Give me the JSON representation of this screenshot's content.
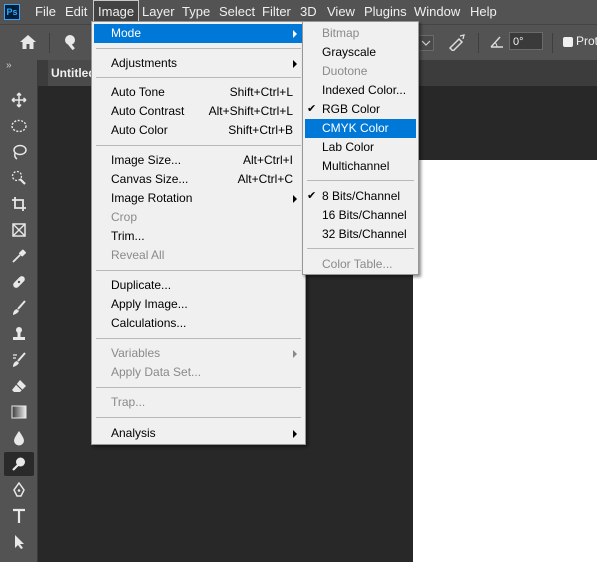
{
  "menubar": {
    "logo": "Ps",
    "items": [
      "File",
      "Edit",
      "Image",
      "Layer",
      "Type",
      "Select",
      "Filter",
      "3D",
      "View",
      "Plugins",
      "Window",
      "Help"
    ]
  },
  "options_bar": {
    "angle_value": "0°",
    "protect_label": "Prote"
  },
  "tools": {
    "collapse": "»",
    "items": [
      "move-tool",
      "marquee-tool",
      "lasso-tool",
      "quick-selection-tool",
      "crop-tool",
      "frame-tool",
      "eyedropper-tool",
      "healing-brush-tool",
      "brush-tool",
      "clone-stamp-tool",
      "history-brush-tool",
      "eraser-tool",
      "gradient-tool",
      "blur-tool",
      "dodge-tool",
      "pen-tool",
      "type-tool",
      "path-selection-tool"
    ],
    "active": "dodge-tool"
  },
  "document": {
    "tab_title": "Untitled"
  },
  "image_menu": {
    "mode": "Mode",
    "adjustments": "Adjustments",
    "auto_tone": "Auto Tone",
    "auto_tone_sc": "Shift+Ctrl+L",
    "auto_contrast": "Auto Contrast",
    "auto_contrast_sc": "Alt+Shift+Ctrl+L",
    "auto_color": "Auto Color",
    "auto_color_sc": "Shift+Ctrl+B",
    "image_size": "Image Size...",
    "image_size_sc": "Alt+Ctrl+I",
    "canvas_size": "Canvas Size...",
    "canvas_size_sc": "Alt+Ctrl+C",
    "image_rotation": "Image Rotation",
    "crop": "Crop",
    "trim": "Trim...",
    "reveal_all": "Reveal All",
    "duplicate": "Duplicate...",
    "apply_image": "Apply Image...",
    "calculations": "Calculations...",
    "variables": "Variables",
    "apply_data_set": "Apply Data Set...",
    "trap": "Trap...",
    "analysis": "Analysis"
  },
  "mode_menu": {
    "bitmap": "Bitmap",
    "grayscale": "Grayscale",
    "duotone": "Duotone",
    "indexed_color": "Indexed Color...",
    "rgb_color": "RGB Color",
    "cmyk_color": "CMYK Color",
    "lab_color": "Lab Color",
    "multichannel": "Multichannel",
    "bits8": "8 Bits/Channel",
    "bits16": "16 Bits/Channel",
    "bits32": "32 Bits/Channel",
    "color_table": "Color Table...",
    "check_glyph": "✔"
  },
  "colors": {
    "menubar_bg": "#535353",
    "menu_bg": "#f0f0f0",
    "highlight": "#0078d7",
    "canvas_bg": "#282828",
    "document": "#ffffff"
  }
}
